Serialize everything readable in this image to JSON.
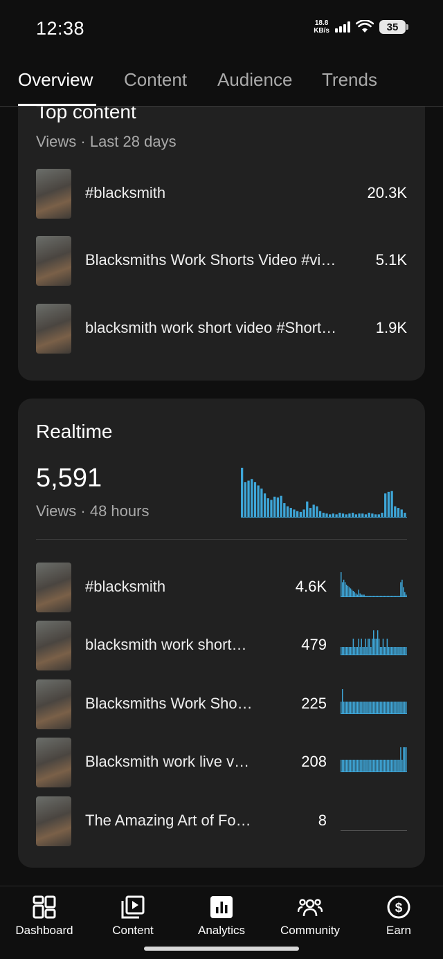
{
  "status_bar": {
    "time": "12:38",
    "net_speed_value": "18.8",
    "net_speed_unit": "KB/s",
    "battery": "35"
  },
  "tabs": [
    {
      "label": "Overview",
      "active": true
    },
    {
      "label": "Content",
      "active": false
    },
    {
      "label": "Audience",
      "active": false
    },
    {
      "label": "Trends",
      "active": false
    }
  ],
  "top_content": {
    "title": "Top content",
    "subtitle": "Views · Last 28 days",
    "items": [
      {
        "title": "#blacksmith",
        "value": "20.3K"
      },
      {
        "title": "Blacksmiths Work Shorts Video #vi…",
        "value": "5.1K"
      },
      {
        "title": "blacksmith work short video #Short…",
        "value": "1.9K"
      }
    ]
  },
  "realtime": {
    "title": "Realtime",
    "views": "5,591",
    "subtitle": "Views · 48 hours",
    "items": [
      {
        "title": "#blacksmith",
        "value": "4.6K"
      },
      {
        "title": "blacksmith work short…",
        "value": "479"
      },
      {
        "title": "Blacksmiths Work Sho…",
        "value": "225"
      },
      {
        "title": "Blacksmith work live v…",
        "value": "208"
      },
      {
        "title": "The Amazing Art of Fo…",
        "value": "8"
      }
    ]
  },
  "chart_data": [
    {
      "type": "bar",
      "series": [
        {
          "values": [
            62,
            44,
            46,
            48,
            44,
            40,
            36,
            30,
            24,
            22,
            26,
            25,
            27,
            18,
            14,
            12,
            10,
            8,
            7,
            10,
            20,
            12,
            16,
            14,
            8,
            6,
            5,
            4,
            5,
            4,
            6,
            5,
            4,
            5,
            6,
            4,
            5,
            5,
            4,
            6,
            5,
            4,
            4,
            6,
            30,
            32,
            33,
            14,
            12,
            10,
            6
          ]
        }
      ]
    },
    {
      "type": "bar",
      "series": [
        {
          "values": [
            20,
            12,
            14,
            12,
            10,
            9,
            8,
            7,
            6,
            5,
            4,
            3,
            2,
            6,
            3,
            2,
            2,
            2,
            1,
            1,
            1,
            1,
            1,
            1,
            1,
            1,
            1,
            1,
            1,
            1,
            1,
            1,
            1,
            1,
            1,
            1,
            1,
            1,
            1,
            1,
            1,
            1,
            1,
            1,
            12,
            14,
            8,
            4,
            2
          ]
        }
      ]
    },
    {
      "type": "bar",
      "series": [
        {
          "values": [
            1,
            1,
            1,
            1,
            1,
            1,
            1,
            1,
            1,
            2,
            1,
            1,
            1,
            2,
            1,
            2,
            1,
            1,
            2,
            1,
            2,
            2,
            1,
            2,
            3,
            2,
            2,
            3,
            2,
            1,
            1,
            2,
            1,
            1,
            2,
            1,
            1,
            1,
            1,
            1,
            1,
            1,
            1,
            1,
            1,
            1,
            1,
            1,
            1
          ]
        }
      ]
    },
    {
      "type": "bar",
      "series": [
        {
          "values": [
            1,
            2,
            1,
            1,
            1,
            1,
            1,
            1,
            1,
            1,
            1,
            1,
            1,
            1,
            1,
            1,
            1,
            1,
            1,
            1,
            1,
            1,
            1,
            1,
            1,
            1,
            1,
            1,
            1,
            1,
            1,
            1,
            1,
            1,
            1,
            1,
            1,
            1,
            1,
            1,
            1,
            1,
            1,
            1,
            1,
            1,
            1,
            1,
            1
          ]
        }
      ]
    },
    {
      "type": "bar",
      "series": [
        {
          "values": [
            1,
            1,
            1,
            1,
            1,
            1,
            1,
            1,
            1,
            1,
            1,
            1,
            1,
            1,
            1,
            1,
            1,
            1,
            1,
            1,
            1,
            1,
            1,
            1,
            1,
            1,
            1,
            1,
            1,
            1,
            1,
            1,
            1,
            1,
            1,
            1,
            1,
            1,
            1,
            1,
            1,
            1,
            1,
            1,
            2,
            1,
            2,
            2,
            2
          ]
        }
      ]
    },
    {
      "type": "bar",
      "series": [
        {
          "values": [
            0,
            0,
            0,
            0,
            0,
            0,
            0,
            0,
            0,
            0,
            0,
            0,
            0,
            0,
            0,
            0,
            0,
            0,
            0,
            0,
            0,
            0,
            0,
            0,
            0,
            0,
            0,
            0,
            0,
            0,
            0,
            0,
            0,
            0,
            0,
            0,
            0,
            0,
            0,
            0,
            0,
            0,
            0,
            0,
            0,
            0,
            0,
            0,
            0
          ]
        }
      ]
    }
  ],
  "colors": {
    "accent": "#3ea6d8",
    "card": "#212121",
    "bg": "#0f0f0f"
  },
  "bottom_nav": [
    {
      "label": "Dashboard",
      "icon": "dashboard-icon"
    },
    {
      "label": "Content",
      "icon": "content-icon"
    },
    {
      "label": "Analytics",
      "icon": "analytics-icon"
    },
    {
      "label": "Community",
      "icon": "community-icon"
    },
    {
      "label": "Earn",
      "icon": "earn-icon"
    }
  ]
}
